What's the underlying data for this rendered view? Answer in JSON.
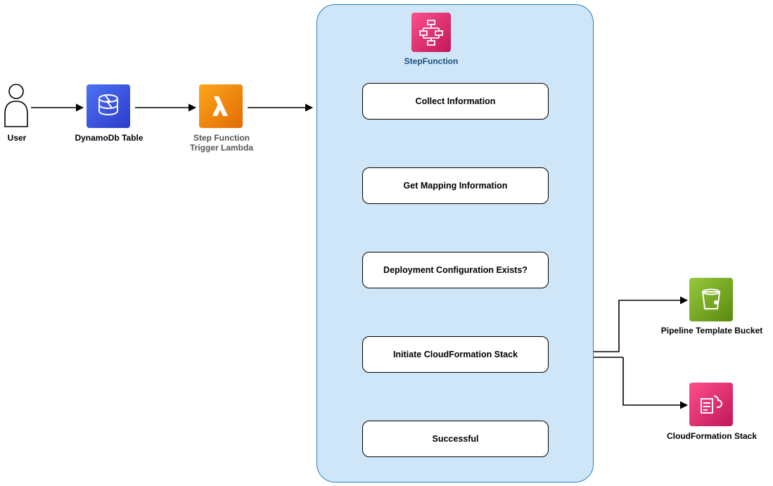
{
  "nodes": {
    "user": {
      "label": "User"
    },
    "dynamodb": {
      "label": "DynamoDb Table"
    },
    "trigger_lambda": {
      "label_line1": "Step Function",
      "label_line2": "Trigger Lambda"
    },
    "stepfunction_header": {
      "label": "StepFunction"
    },
    "pipeline_bucket": {
      "label": "Pipeline Template Bucket"
    },
    "cloudformation_stack": {
      "label": "CloudFormation Stack"
    }
  },
  "states": {
    "collect_info": {
      "label": "Collect Information"
    },
    "get_mapping": {
      "label": "Get Mapping Information"
    },
    "deploy_config": {
      "label": "Deployment Configuration Exists?"
    },
    "initiate_cfn": {
      "label": "Initiate CloudFormation Stack"
    },
    "successful": {
      "label": "Successful"
    }
  },
  "colors": {
    "stepfunction_pink": "#E7157B",
    "lambda_orange": "#ED7100",
    "dynamodb_blue": "#3B48CC",
    "s3_green": "#7AA116",
    "cloudformation_pink": "#E7157B",
    "container_bg": "#cfe6f9",
    "container_border": "#2a7fbf"
  }
}
